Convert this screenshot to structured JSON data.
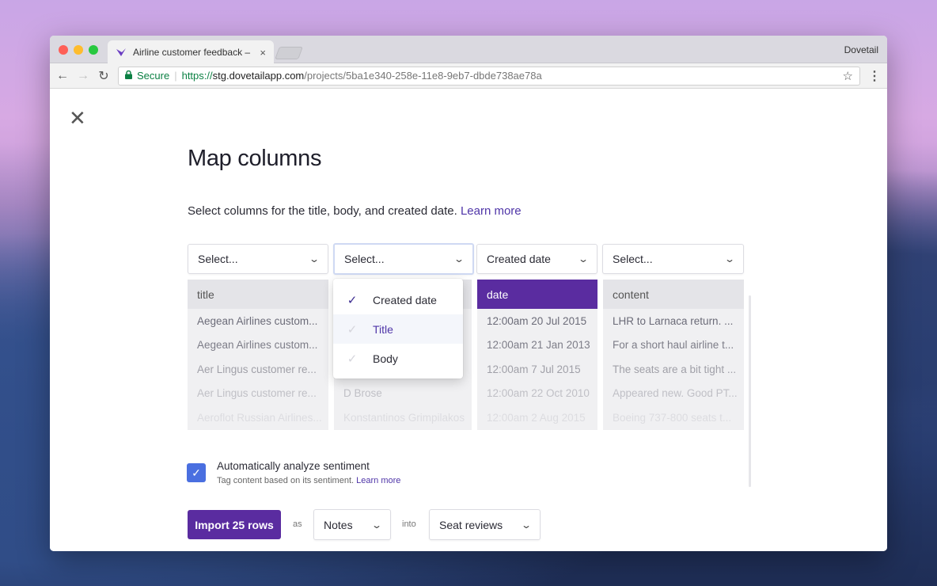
{
  "browser": {
    "tab_title": "Airline customer feedback – Do",
    "tab_close": "×",
    "profile_name": "Dovetail",
    "secure_label": "Secure",
    "url_scheme": "https://",
    "url_host": "stg.dovetailapp.com",
    "url_path": "/projects/5ba1e340-258e-11e8-9eb7-dbde738ae78a",
    "icons": {
      "back": "←",
      "forward": "→",
      "reload": "↻",
      "star": "☆",
      "menu": "⋮",
      "lock": "🔒"
    }
  },
  "page": {
    "close_icon": "✕",
    "title": "Map columns",
    "subtitle": "Select columns for the title, body, and created date.",
    "subtitle_link": "Learn more"
  },
  "columns": [
    {
      "select_value": "Select...",
      "header": "title",
      "cells": [
        "Aegean Airlines custom...",
        "Aegean Airlines custom...",
        "Aer Lingus customer re...",
        "Aer Lingus customer re...",
        "Aeroflot Russian Airlines..."
      ]
    },
    {
      "select_value": "Select...",
      "header": "",
      "cells": [
        "",
        "",
        "",
        "D Brose",
        "Konstantinos Grimpilakos"
      ]
    },
    {
      "select_value": "Created date",
      "header": "date",
      "cells": [
        "12:00am 20 Jul 2015",
        "12:00am 21 Jan 2013",
        "12:00am 7 Jul 2015",
        "12:00am 22 Oct 2010",
        "12:00am 2 Aug 2015"
      ]
    },
    {
      "select_value": "Select...",
      "header": "content",
      "cells": [
        "LHR to Larnaca return. ...",
        "For a short haul airline t...",
        "The seats are a bit tight ...",
        "Appeared new. Good PT...",
        "Boeing 737-800 seats t..."
      ]
    }
  ],
  "dropdown": {
    "options": [
      {
        "label": "Created date",
        "checked": true
      },
      {
        "label": "Title",
        "checked": false
      },
      {
        "label": "Body",
        "checked": false
      }
    ]
  },
  "sentiment": {
    "checkbox_checked": true,
    "label": "Automatically analyze sentiment",
    "sublabel": "Tag content based on its sentiment.",
    "sublabel_link": "Learn more"
  },
  "import": {
    "button_label": "Import 25 rows",
    "as_label": "as",
    "type_value": "Notes",
    "into_label": "into",
    "target_value": "Seat reviews"
  },
  "colors": {
    "accent": "#5a2ca0",
    "link": "#4f35a8",
    "checkbox": "#4a6fe0"
  }
}
